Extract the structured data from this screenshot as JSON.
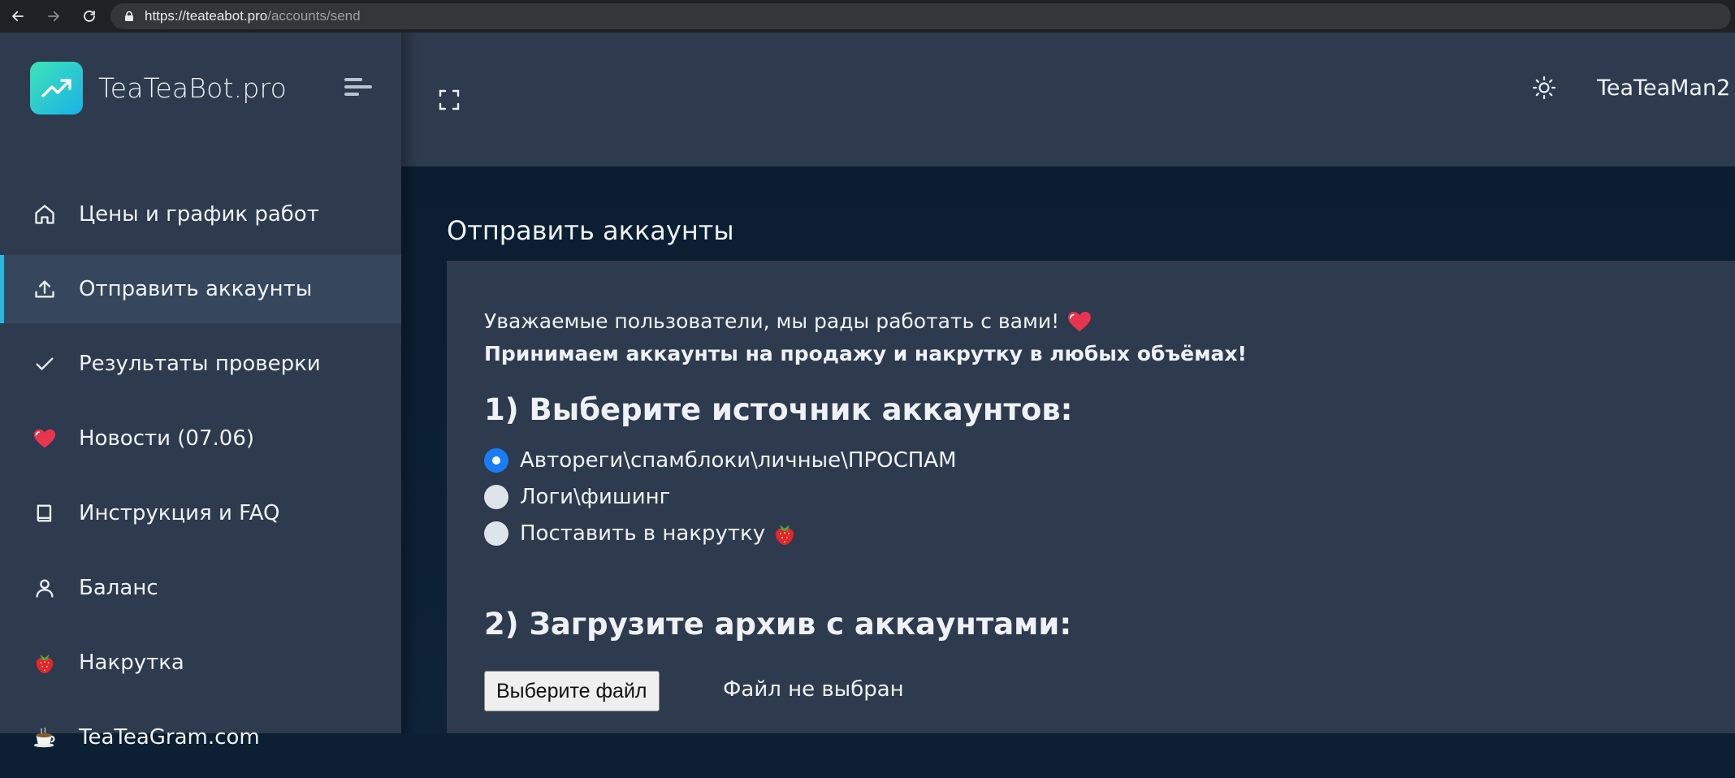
{
  "browser": {
    "url_host": "https://teateabot.pro",
    "url_path": "/accounts/send"
  },
  "brand": {
    "name": "TeaTeaBot.pro"
  },
  "sidebar": {
    "items": [
      {
        "label": "Цены и график работ",
        "icon": "home-icon"
      },
      {
        "label": "Отправить аккаунты",
        "icon": "upload-icon",
        "active": true
      },
      {
        "label": "Результаты проверки",
        "icon": "check-icon"
      },
      {
        "label": "Новости (07.06)",
        "icon": "heart-emoji-icon"
      },
      {
        "label": "Инструкция и FAQ",
        "icon": "book-icon"
      },
      {
        "label": "Баланс",
        "icon": "user-icon"
      },
      {
        "label": "Накрутка",
        "icon": "strawberry-emoji-icon"
      },
      {
        "label": "TeaTeaGram.com",
        "icon": "tea-cup-emoji-icon"
      }
    ]
  },
  "header": {
    "username": "TeaTeaMan2"
  },
  "main": {
    "title": "Отправить аккаунты",
    "greeting": "Уважаемые пользователи, мы рады работать с вами!",
    "notice": "Принимаем аккаунты на продажу и накрутку в любых объёмах!",
    "step1_heading": "1) Выберите источник аккаунтов:",
    "sources": [
      {
        "label": "Автореги\\спамблоки\\личные\\ПРОСПАМ",
        "checked": true
      },
      {
        "label": "Логи\\фишинг",
        "checked": false
      },
      {
        "label": "Поставить в накрутку",
        "checked": false
      }
    ],
    "step2_heading": "2) Загрузите архив с аккаунтами:",
    "file_button": "Выберите файл",
    "file_status": "Файл не выбран"
  },
  "colors": {
    "sidebar_bg": "#2e3a4d",
    "content_bg": "#0b1d31",
    "accent": "#28b8e0",
    "radio_checked": "#1a7cf5"
  }
}
